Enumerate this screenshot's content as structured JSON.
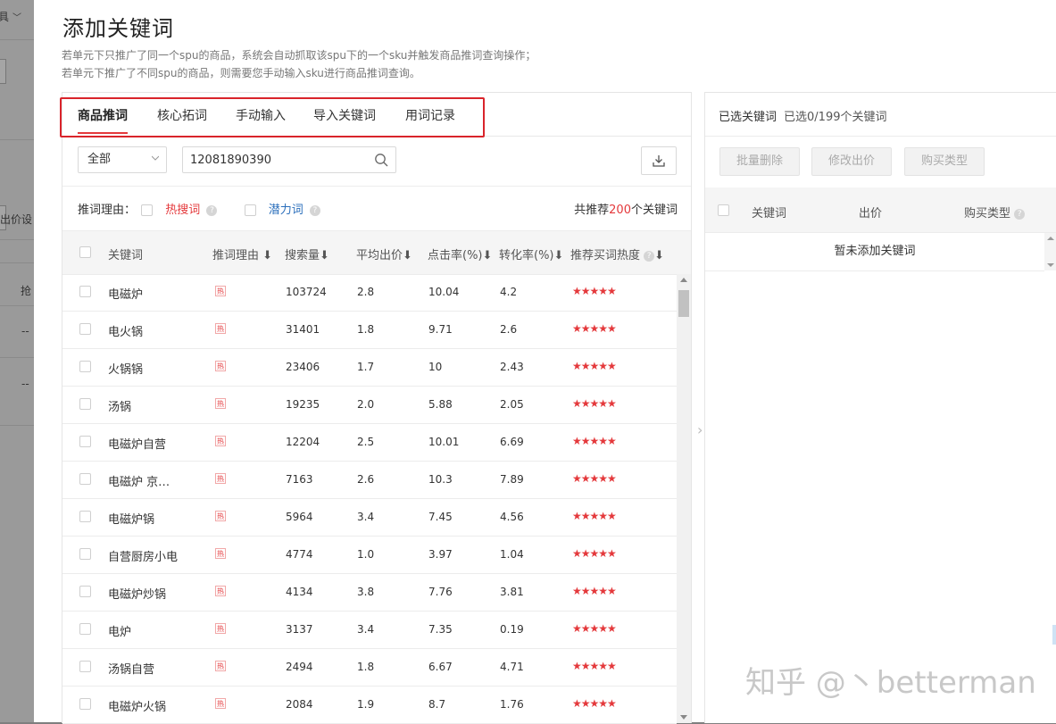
{
  "background": {
    "fragments": [
      "具",
      "出价设",
      "抢",
      "--",
      "--"
    ]
  },
  "modal": {
    "title": "添加关键词",
    "desc_line1": "若单元下只推广了同一个spu的商品，系统会自动抓取该spu下的一个sku并触发商品推词查询操作；",
    "desc_line2": "若单元下推广了不同spu的商品，则需要您手动输入sku进行商品推词查询。"
  },
  "tabs": [
    {
      "label": "商品推词",
      "active": true
    },
    {
      "label": "核心拓词",
      "active": false
    },
    {
      "label": "手动输入",
      "active": false
    },
    {
      "label": "导入关键词",
      "active": false
    },
    {
      "label": "用词记录",
      "active": false
    }
  ],
  "filter": {
    "select_value": "全部",
    "search_value": "12081890390"
  },
  "reason": {
    "label": "推词理由：",
    "hot_label": "热搜词",
    "potential_label": "潜力词",
    "recommend_prefix": "共推荐",
    "recommend_count": "200",
    "recommend_suffix": "个关键词"
  },
  "table": {
    "headers": {
      "keyword": "关键词",
      "reason": "推词理由",
      "search": "搜索量",
      "price": "平均出价",
      "ctr": "点击率(%)",
      "cvr": "转化率(%)",
      "heat": "推荐买词热度"
    },
    "hot_badge": "热",
    "stars": "★★★★★",
    "rows": [
      {
        "keyword": "电磁炉",
        "search": "103724",
        "price": "2.8",
        "ctr": "10.04",
        "cvr": "4.2"
      },
      {
        "keyword": "电火锅",
        "search": "31401",
        "price": "1.8",
        "ctr": "9.71",
        "cvr": "2.6"
      },
      {
        "keyword": "火锅锅",
        "search": "23406",
        "price": "1.7",
        "ctr": "10",
        "cvr": "2.43"
      },
      {
        "keyword": "汤锅",
        "search": "19235",
        "price": "2.0",
        "ctr": "5.88",
        "cvr": "2.05"
      },
      {
        "keyword": "电磁炉自营",
        "search": "12204",
        "price": "2.5",
        "ctr": "10.01",
        "cvr": "6.69"
      },
      {
        "keyword": "电磁炉 京…",
        "search": "7163",
        "price": "2.6",
        "ctr": "10.3",
        "cvr": "7.89"
      },
      {
        "keyword": "电磁炉锅",
        "search": "5964",
        "price": "3.4",
        "ctr": "7.45",
        "cvr": "4.56"
      },
      {
        "keyword": "自营厨房小电",
        "search": "4774",
        "price": "1.0",
        "ctr": "3.97",
        "cvr": "1.04"
      },
      {
        "keyword": "电磁炉炒锅",
        "search": "4134",
        "price": "3.8",
        "ctr": "7.76",
        "cvr": "3.81"
      },
      {
        "keyword": "电炉",
        "search": "3137",
        "price": "3.4",
        "ctr": "7.35",
        "cvr": "0.19"
      },
      {
        "keyword": "汤锅自营",
        "search": "2494",
        "price": "1.8",
        "ctr": "6.67",
        "cvr": "4.71"
      },
      {
        "keyword": "电磁炉火锅",
        "search": "2084",
        "price": "1.9",
        "ctr": "8.7",
        "cvr": "1.76"
      }
    ]
  },
  "right": {
    "title": "已选关键词",
    "count_text": "已选0/199个关键词",
    "btn_delete": "批量删除",
    "btn_price": "修改出价",
    "btn_type": "购买类型",
    "col_keyword": "关键词",
    "col_price": "出价",
    "col_type": "购买类型",
    "empty_text": "暂未添加关键词"
  },
  "watermark": "知乎 @丶betterman",
  "colors": {
    "accent": "#e4393c",
    "potential": "#2a6ebb",
    "highlight_box": "#d9242b"
  }
}
